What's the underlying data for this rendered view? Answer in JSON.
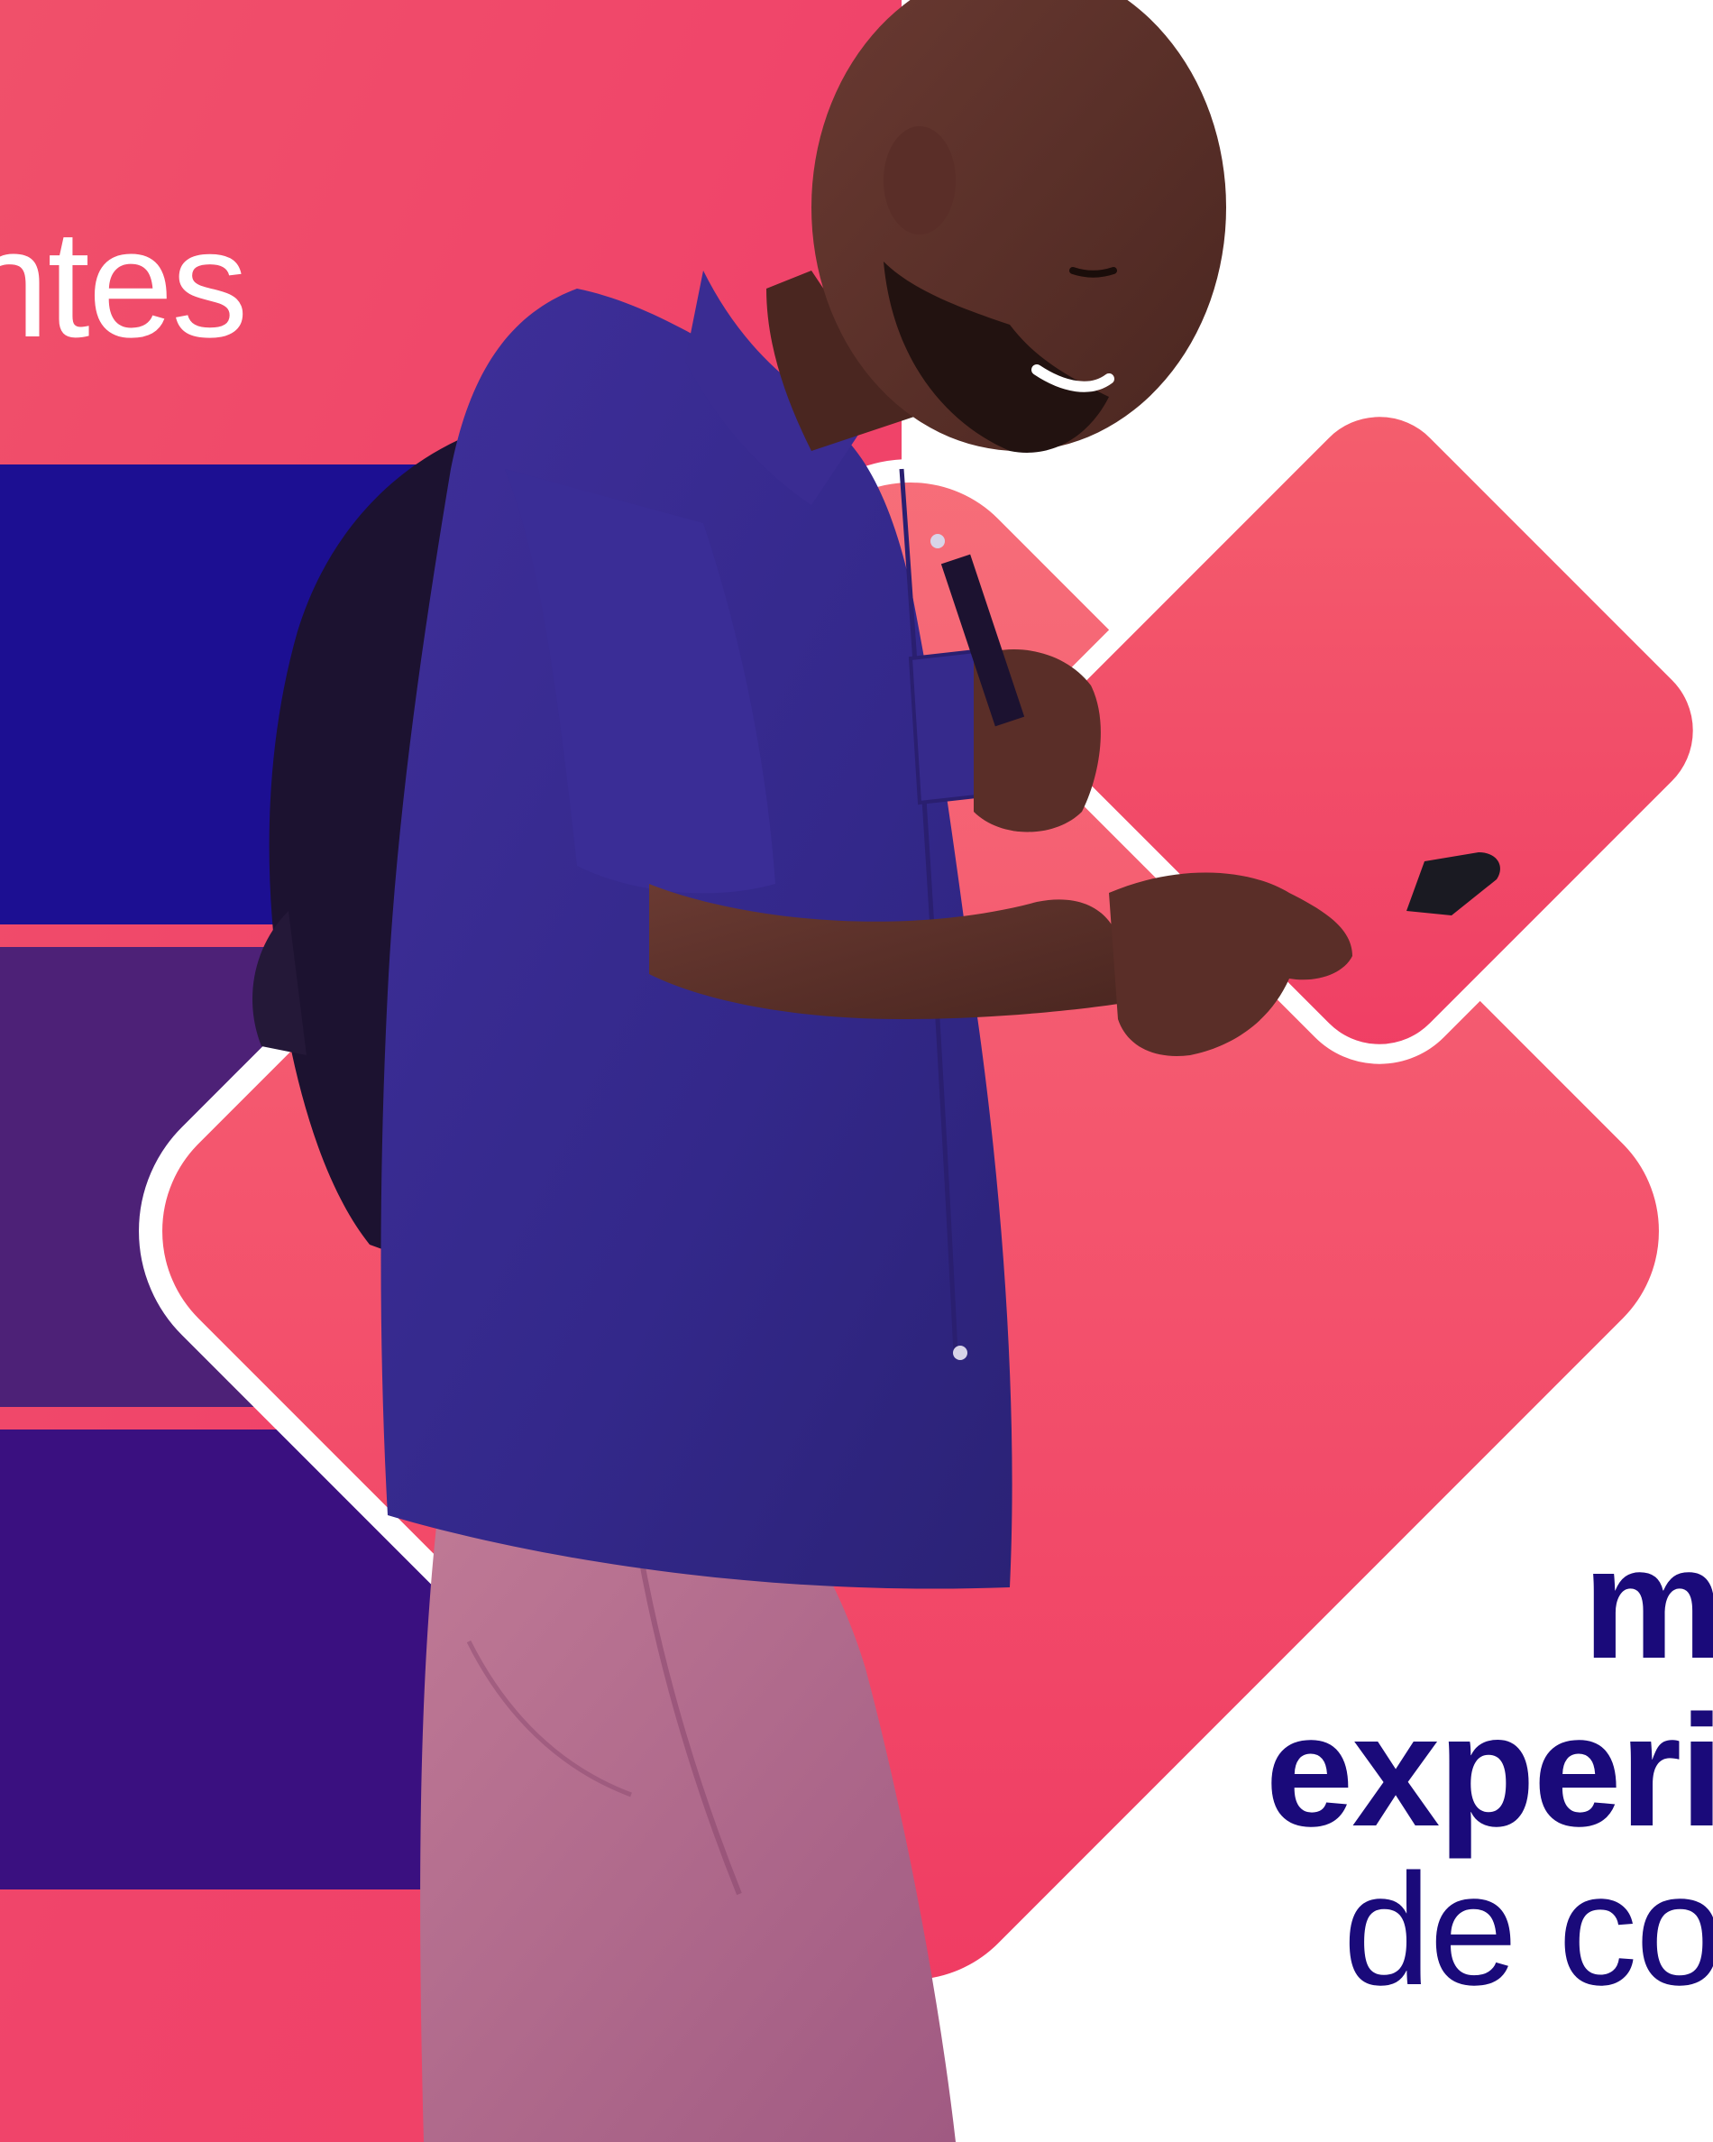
{
  "headline": {
    "text": "ntes"
  },
  "message": {
    "line1": "m",
    "line2": "experi",
    "line3": "de co"
  },
  "colors": {
    "coral": "#f04a6a",
    "coral_light": "#f45c72",
    "navy_blue": "#1c0f92",
    "purple_mid": "#4d2177",
    "purple_dark": "#3a1080",
    "text_navy": "#1a0a7a",
    "white": "#ffffff"
  },
  "photo": {
    "subject": "man-walking-with-phone"
  }
}
